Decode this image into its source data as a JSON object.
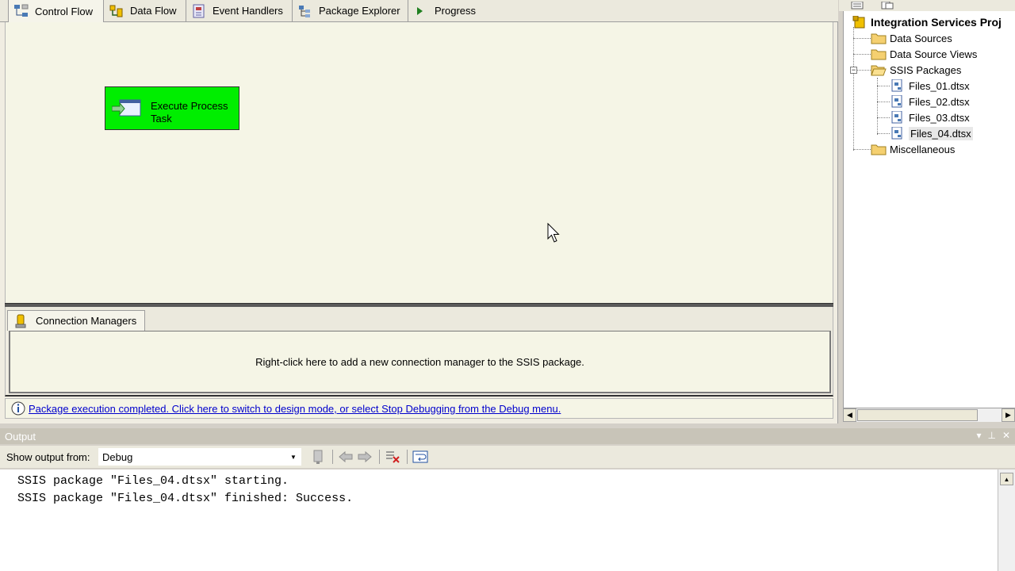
{
  "designer": {
    "tabs": [
      {
        "label": "Control Flow",
        "icon": "control-flow-icon",
        "active": true
      },
      {
        "label": "Data Flow",
        "icon": "data-flow-icon",
        "active": false
      },
      {
        "label": "Event Handlers",
        "icon": "event-handlers-icon",
        "active": false
      },
      {
        "label": "Package Explorer",
        "icon": "package-explorer-icon",
        "active": false
      },
      {
        "label": "Progress",
        "icon": "progress-arrow-icon",
        "active": false
      }
    ],
    "task": {
      "label_line1": "Execute Process",
      "label_line2": "Task",
      "color": "#00ee00"
    },
    "connection_managers": {
      "tab_label": "Connection Managers",
      "hint": "Right-click here to add a new connection manager to the SSIS package."
    },
    "infobar": {
      "message": "Package execution completed. Click here to switch to design mode, or select Stop Debugging from the Debug menu."
    }
  },
  "solution_explorer": {
    "root": "Integration Services Proj",
    "items": [
      {
        "label": "Data Sources",
        "type": "folder"
      },
      {
        "label": "Data Source Views",
        "type": "folder"
      },
      {
        "label": "SSIS Packages",
        "type": "folder",
        "expanded": true
      },
      {
        "label": "Files_01.dtsx",
        "type": "package"
      },
      {
        "label": "Files_02.dtsx",
        "type": "package"
      },
      {
        "label": "Files_03.dtsx",
        "type": "package"
      },
      {
        "label": "Files_04.dtsx",
        "type": "package",
        "selected": true
      },
      {
        "label": "Miscellaneous",
        "type": "folder"
      }
    ]
  },
  "output": {
    "title": "Output",
    "show_from_label": "Show output from:",
    "source": "Debug",
    "lines": [
      "SSIS package \"Files_04.dtsx\" starting.",
      "SSIS package \"Files_04.dtsx\" finished: Success."
    ]
  }
}
